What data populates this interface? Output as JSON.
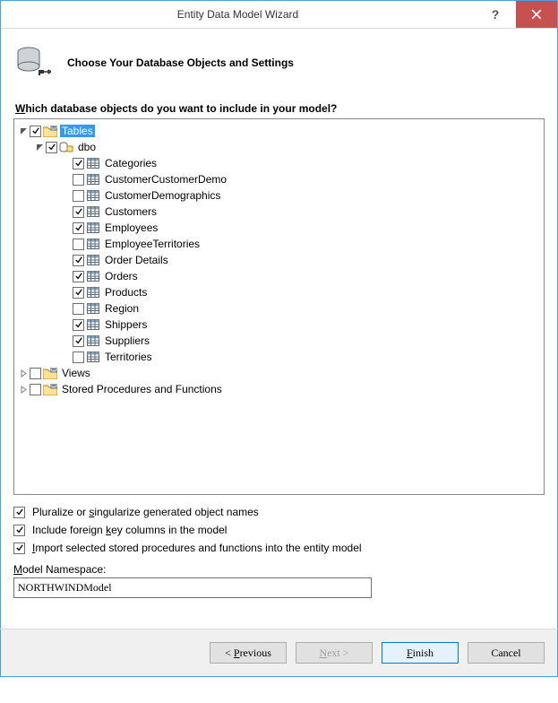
{
  "title": "Entity Data Model Wizard",
  "subtitle": "Choose Your Database Objects and Settings",
  "prompt_pre": "W",
  "prompt_rest": "hich database objects do you want to include in your model?",
  "root": {
    "tables": "Tables",
    "dbo": "dbo",
    "items": [
      {
        "label": "Categories",
        "checked": true
      },
      {
        "label": "CustomerCustomerDemo",
        "checked": false
      },
      {
        "label": "CustomerDemographics",
        "checked": false
      },
      {
        "label": "Customers",
        "checked": true
      },
      {
        "label": "Employees",
        "checked": true
      },
      {
        "label": "EmployeeTerritories",
        "checked": false
      },
      {
        "label": "Order Details",
        "checked": true
      },
      {
        "label": "Orders",
        "checked": true
      },
      {
        "label": "Products",
        "checked": true
      },
      {
        "label": "Region",
        "checked": false
      },
      {
        "label": "Shippers",
        "checked": true
      },
      {
        "label": "Suppliers",
        "checked": true
      },
      {
        "label": "Territories",
        "checked": false
      }
    ],
    "views": "Views",
    "sprocs": "Stored Procedures and Functions"
  },
  "opts": {
    "plural_pre": "Pluralize or ",
    "plural_u": "s",
    "plural_post": "ingularize generated object names",
    "fk_pre": "Include foreign ",
    "fk_u": "k",
    "fk_post": "ey columns in the model",
    "imp_pre": "",
    "imp_u": "I",
    "imp_post": "mport selected stored procedures and functions into the entity model"
  },
  "ns": {
    "label_pre": "",
    "label_u": "M",
    "label_post": "odel Namespace:",
    "value": "NORTHWINDModel"
  },
  "btn": {
    "prev_pre": "< ",
    "prev_u": "P",
    "prev_post": "revious",
    "next_pre": "",
    "next_u": "N",
    "next_post": "ext >",
    "finish_pre": "",
    "finish_u": "F",
    "finish_post": "inish",
    "cancel": "Cancel"
  }
}
